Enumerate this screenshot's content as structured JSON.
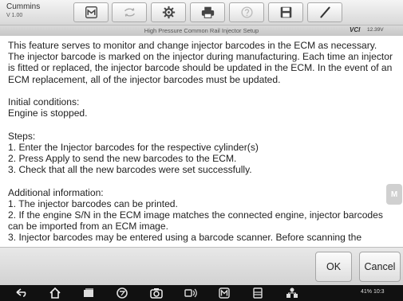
{
  "app": {
    "brand": "Cummins",
    "version": "V 1.00"
  },
  "toolbar": {
    "buttons": [
      {
        "icon": "home-icon",
        "enabled": true
      },
      {
        "icon": "vehicle-swap-icon",
        "enabled": false
      },
      {
        "icon": "settings-icon",
        "enabled": true
      },
      {
        "icon": "print-icon",
        "enabled": true
      },
      {
        "icon": "help-icon",
        "enabled": false
      },
      {
        "icon": "save-icon",
        "enabled": true
      },
      {
        "icon": "pen-icon",
        "enabled": true
      }
    ]
  },
  "status": {
    "title": "High Pressure Common Rail Injector Setup",
    "vci": "VCI",
    "voltage": "12.39V"
  },
  "content": {
    "intro": "This feature serves to monitor and change injector barcodes in the ECM as necessary. The injector barcode is marked on the injector during manufacturing. Each time an injector is fitted or replaced, the injector barcode should be updated in the ECM. In the event of an ECM replacement, all of the injector barcodes must be updated.",
    "conditions_title": "Initial conditions:",
    "conditions": "Engine is stopped.",
    "steps_title": "Steps:",
    "steps": [
      "1. Enter the Injector barcodes for the respective cylinder(s)",
      "2. Press Apply to send the new barcodes to the ECM.",
      "3. Check that all the new barcodes were set successfully."
    ],
    "additional_title": "Additional information:",
    "additional": [
      "1. The injector barcodes can be printed.",
      "2. If the engine S/N in the ECM image matches the connected engine, injector barcodes can be imported from an ECM image.",
      "3. Injector barcodes may be entered using a barcode scanner. Before scanning the"
    ],
    "side_handle": "M"
  },
  "footer": {
    "ok_label": "OK",
    "cancel_label": "Cancel"
  },
  "navbar": {
    "icons": [
      "back-icon",
      "home-icon",
      "recent-apps-icon",
      "browser-icon",
      "camera-icon",
      "vci-icon",
      "maxisys-icon",
      "apps-icon",
      "network-icon"
    ],
    "status_text": "41% 10:3"
  }
}
